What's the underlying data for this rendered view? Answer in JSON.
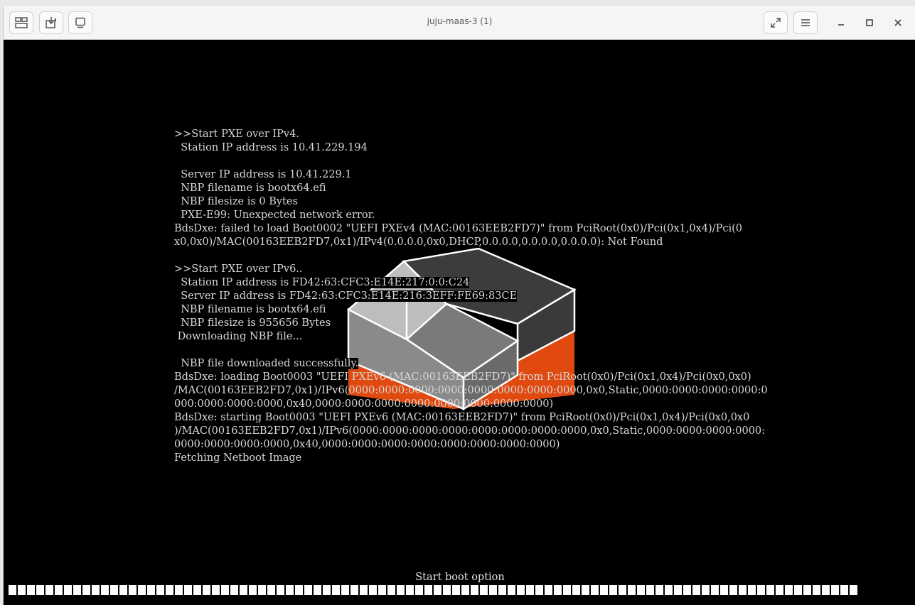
{
  "window": {
    "title": "juju-maas-3 (1)"
  },
  "toolbar": {
    "icons": [
      "displays-icon",
      "send-keys-icon",
      "screen-icon"
    ],
    "right_icons": [
      "fullscreen-icon",
      "hamburger-menu-icon",
      "minimize-icon",
      "maximize-icon",
      "close-icon"
    ]
  },
  "console": {
    "lines": [
      ">>Start PXE over IPv4.",
      "  Station IP address is 10.41.229.194",
      "",
      "  Server IP address is 10.41.229.1",
      "  NBP filename is bootx64.efi",
      "  NBP filesize is 0 Bytes",
      "  PXE-E99: Unexpected network error.",
      "BdsDxe: failed to load Boot0002 \"UEFI PXEv4 (MAC:00163EEB2FD7)\" from PciRoot(0x0)/Pci(0x1,0x4)/Pci(0",
      "x0,0x0)/MAC(00163EEB2FD7,0x1)/IPv4(0.0.0.0,0x0,DHCP,0.0.0.0,0.0.0.0,0.0.0.0): Not Found",
      "",
      ">>Start PXE over IPv6..",
      "  Station IP address is FD42:63:CFC3:E14E:217:0:0:C24",
      "  Server IP address is FD42:63:CFC3:E14E:216:3EFF:FE69:83CE",
      "  NBP filename is bootx64.efi",
      "  NBP filesize is 955656 Bytes",
      " Downloading NBP file...",
      "",
      "  NBP file downloaded successfully.",
      "BdsDxe: loading Boot0003 \"UEFI PXEv6 (MAC:00163EEB2FD7)\" from PciRoot(0x0)/Pci(0x1,0x4)/Pci(0x0,0x0)",
      "/MAC(00163EEB2FD7,0x1)/IPv6(0000:0000:0000:0000:0000:0000:0000:0000,0x0,Static,0000:0000:0000:0000:0",
      "000:0000:0000:0000,0x40,0000:0000:0000:0000:0000:0000:0000:0000)",
      "BdsDxe: starting Boot0003 \"UEFI PXEv6 (MAC:00163EEB2FD7)\" from PciRoot(0x0)/Pci(0x1,0x4)/Pci(0x0,0x0",
      ")/MAC(00163EEB2FD7,0x1)/IPv6(0000:0000:0000:0000:0000:0000:0000:0000,0x0,Static,0000:0000:0000:0000:",
      "0000:0000:0000:0000,0x40,0000:0000:0000:0000:0000:0000:0000:0000)",
      "Fetching Netboot Image"
    ]
  },
  "footer": {
    "status": "Start boot option",
    "progress_cells": 92
  },
  "colors": {
    "logo_orange": "#e04a0f",
    "logo_dark": "#3c3c3c",
    "logo_mid": "#7a7a7a",
    "logo_light": "#bdbdbd"
  }
}
